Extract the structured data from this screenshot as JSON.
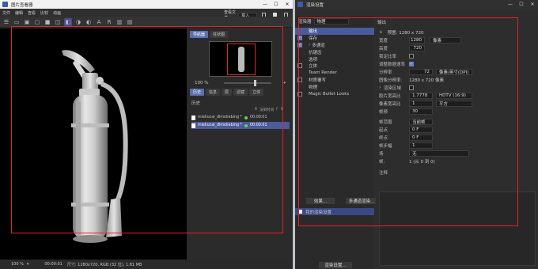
{
  "left_window": {
    "title": "图片查看器",
    "menu": [
      "文件",
      "编辑",
      "查看",
      "比较",
      "动画"
    ],
    "display_dropdown_label": "查看文件",
    "display_dropdown_value": "载入",
    "nav_tabs": [
      "导航器",
      "柱状图"
    ],
    "zoom_value": "100 %",
    "sub_tabs": [
      "历史",
      "信息",
      "层",
      "滤镜",
      "立体"
    ],
    "history_header": "历史",
    "history_columns": [
      "R",
      "渲染时间",
      "F",
      "S"
    ],
    "history_rows": [
      {
        "name": "mieliucai_dlmoliebing *",
        "time": "00:00:01",
        "icon": "film-icon"
      },
      {
        "name": "mieliucai_dlmoliebing *",
        "time": "00:00:01",
        "icon": "film-icon",
        "selected": true
      }
    ],
    "status": {
      "zoom": "100 %",
      "time": "00:00:01",
      "info": "尺寸: 1280x720, RGB (32 位), 1.81 MB"
    }
  },
  "right_window": {
    "title": "渲染设置",
    "renderer_label": "渲染器",
    "renderer_value": "物理",
    "categories": [
      {
        "label": "输出",
        "checkbox": false,
        "selected": true
      },
      {
        "label": "保存",
        "checkbox": true,
        "checked": true
      },
      {
        "label": "多通道",
        "checkbox": true,
        "checked": true,
        "expandable": true
      },
      {
        "label": "抗锯齿",
        "checkbox": false
      },
      {
        "label": "选项",
        "checkbox": false
      },
      {
        "label": "立体",
        "checkbox": true,
        "checked": false
      },
      {
        "label": "Team Render",
        "checkbox": false
      },
      {
        "label": "材质覆写",
        "checkbox": true,
        "checked": false
      },
      {
        "label": "物理",
        "checkbox": false
      },
      {
        "label": "Magic Bullet Looks",
        "checkbox": true,
        "checked": false
      }
    ],
    "buttons": {
      "effect": "效果...",
      "multi_pass": "多通道渲染..."
    },
    "current_setting": "我的渲染设置",
    "footer_button": "渲染设置...",
    "output": {
      "header": "输出",
      "preset": "预置: 1280 x 720",
      "width_label": "宽度",
      "width_value": "1280",
      "width_unit": "像素",
      "height_label": "高度",
      "height_value": "720",
      "lock_ratio_label": "锁定比率",
      "adapt_label": "调整数据速率",
      "resolution_label": "分辨率",
      "resolution_value": "72",
      "resolution_unit": "像素/英寸(DPI)",
      "image_res_label": "图像分辨率:",
      "image_res_value": "1280 x 720 像素",
      "render_region_label": "渲染区域",
      "film_aspect_label": "胶片宽高比",
      "film_aspect_value": "1.7778",
      "film_aspect_preset": "HDTV (16:9)",
      "pixel_aspect_label": "像素宽高比",
      "pixel_aspect_value": "1",
      "pixel_aspect_preset": "平方",
      "fps_label": "帧频",
      "fps_value": "30",
      "frame_range_label": "帧范围",
      "frame_range_value": "当前帧",
      "start_label": "起点",
      "start_value": "0 F",
      "end_label": "终点",
      "end_value": "0 F",
      "step_label": "帧步幅",
      "step_value": "1",
      "field_label": "场",
      "field_value": "无",
      "frames_label": "帧:",
      "frames_value": "1 (从 0 到 0)",
      "notes_label": "注释"
    }
  }
}
